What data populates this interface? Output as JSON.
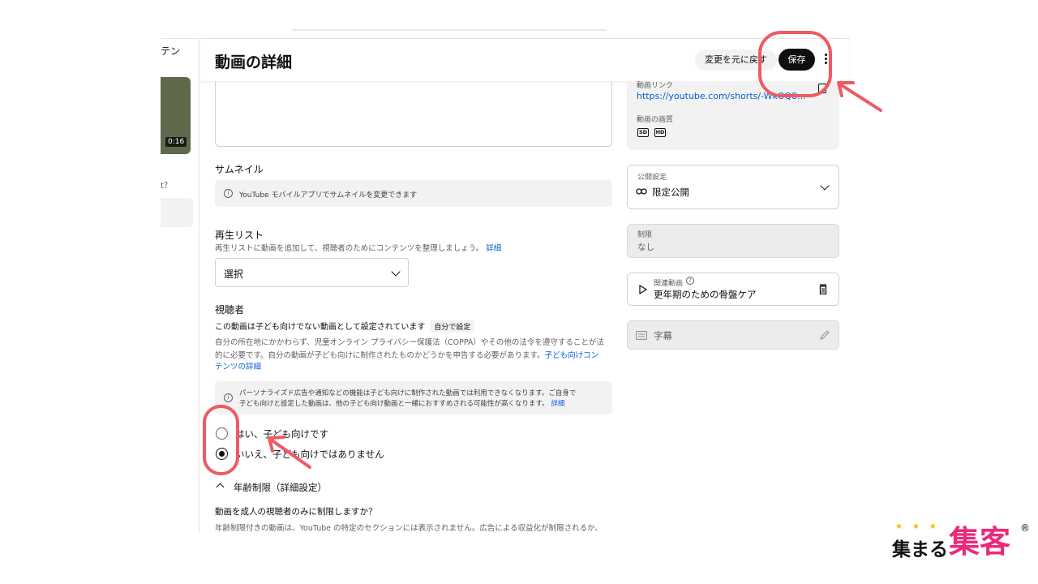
{
  "left_panel": {
    "tab_fragment": "テン",
    "thumb_duration": "0:16",
    "question_fragment": "t？"
  },
  "header": {
    "title": "動画の詳細",
    "revert_label": "変更を元に戻す",
    "save_label": "保存"
  },
  "thumbnail": {
    "title": "サムネイル",
    "info": "YouTube モバイルアプリでサムネイルを変更できます"
  },
  "playlist": {
    "title": "再生リスト",
    "desc": "再生リストに動画を追加して、視聴者のためにコンテンツを整理しましょう。",
    "desc_link": "詳細",
    "select_value": "選択"
  },
  "audience": {
    "title": "視聴者",
    "status": "この動画は子ども向けでない動画として設定されています",
    "status_badge": "自分で設定",
    "desc_line1": "自分の所在地にかかわらず、児童オンライン プライバシー保護法（COPPA）やその他の法令を遵守することが法",
    "desc_line2": "的に必要です。自分の動画が子ども向けに制作されたものかどうかを申告する必要があります。",
    "desc_link_a": "子ども向けコン",
    "desc_link_b": "テンツの詳細",
    "notice_line1": "パーソナライズド広告や通知などの機能は子ども向けに制作された動画では利用できなくなります。ご自身で",
    "notice_line2": "子ども向けと設定した動画は、他の子ども向け動画と一緒におすすめされる可能性が高くなります。",
    "notice_link": "詳細",
    "option_yes": "はい、子ども向けです",
    "option_no": "いいえ、子ども向けではありません",
    "selected": "no"
  },
  "age_restriction": {
    "toggle_label": "年齢制限（詳細設定）",
    "question": "動画を成人の視聴者のみに制限しますか？",
    "desc": "年齢制限付きの動画は、YouTube の特定のセクションには表示されません。広告による収益化が制限されるか、"
  },
  "video_info": {
    "link_label": "動画リンク",
    "link_url": "https://youtube.com/shorts/-WkOQ8...",
    "quality_label": "動画の画質",
    "quality_badges": [
      "SD",
      "HD"
    ]
  },
  "visibility": {
    "label": "公開設定",
    "value": "限定公開"
  },
  "restrictions": {
    "label": "制限",
    "value": "なし"
  },
  "related_video": {
    "label": "関連動画",
    "value": "更年期のための骨盤ケア"
  },
  "captions": {
    "label": "字幕"
  },
  "brand": {
    "stars": "★★★",
    "text_small": "集まる",
    "text_large": "集客",
    "reg": "®"
  },
  "colors": {
    "annotation_red": "#ef5a62",
    "link_blue": "#065fd4",
    "brand_pink": "#ea2a7a"
  }
}
